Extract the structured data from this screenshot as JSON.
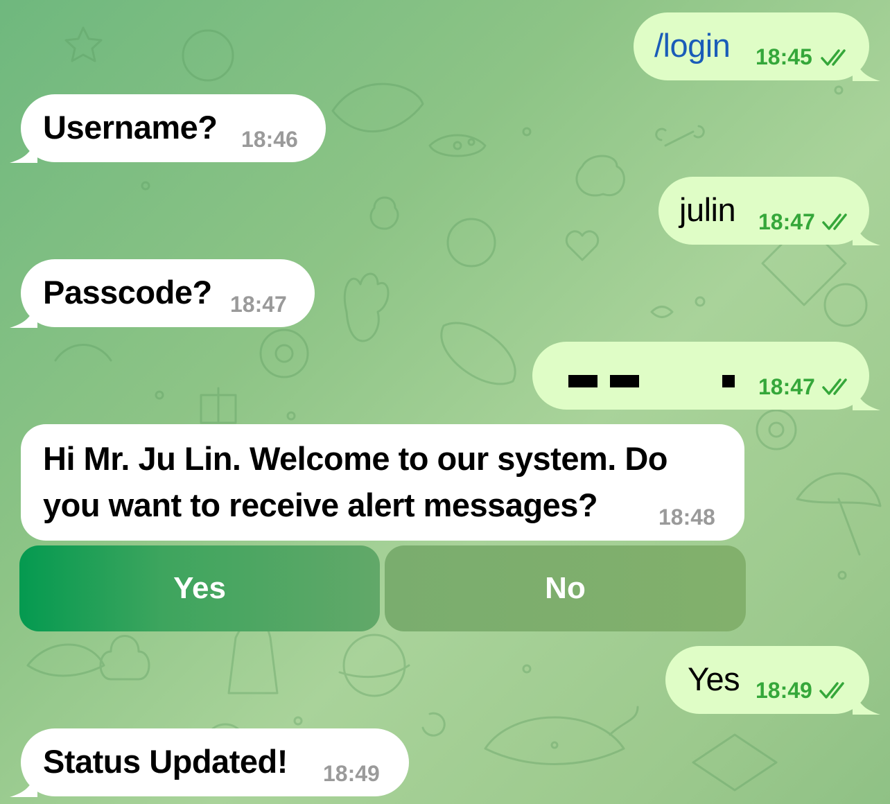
{
  "messages": [
    {
      "side": "out",
      "text": "/login",
      "time": "18:45"
    },
    {
      "side": "in",
      "text": "Username?",
      "time": "18:46"
    },
    {
      "side": "out",
      "text": "julin",
      "time": "18:47"
    },
    {
      "side": "in",
      "text": "Passcode?",
      "time": "18:47"
    },
    {
      "side": "out",
      "text": "",
      "time": "18:47",
      "redacted": true
    },
    {
      "side": "in",
      "text_line1": "Hi Mr. Ju Lin. Welcome to our system. Do",
      "text_line2": "you want to receive alert messages?",
      "time": "18:48"
    },
    {
      "side": "out",
      "text": "Yes",
      "time": "18:49"
    },
    {
      "side": "in",
      "text": "Status Updated!",
      "time": "18:49"
    }
  ],
  "keyboard": {
    "yes_label": "Yes",
    "no_label": "No"
  },
  "colors": {
    "incoming": "#ffffff",
    "outgoing": "#dffdc6",
    "time_out": "#35a73a",
    "time_in": "#9a9a9a",
    "command_link": "#1a5cb8"
  },
  "icons": {
    "read_receipt": "double-check-icon"
  }
}
